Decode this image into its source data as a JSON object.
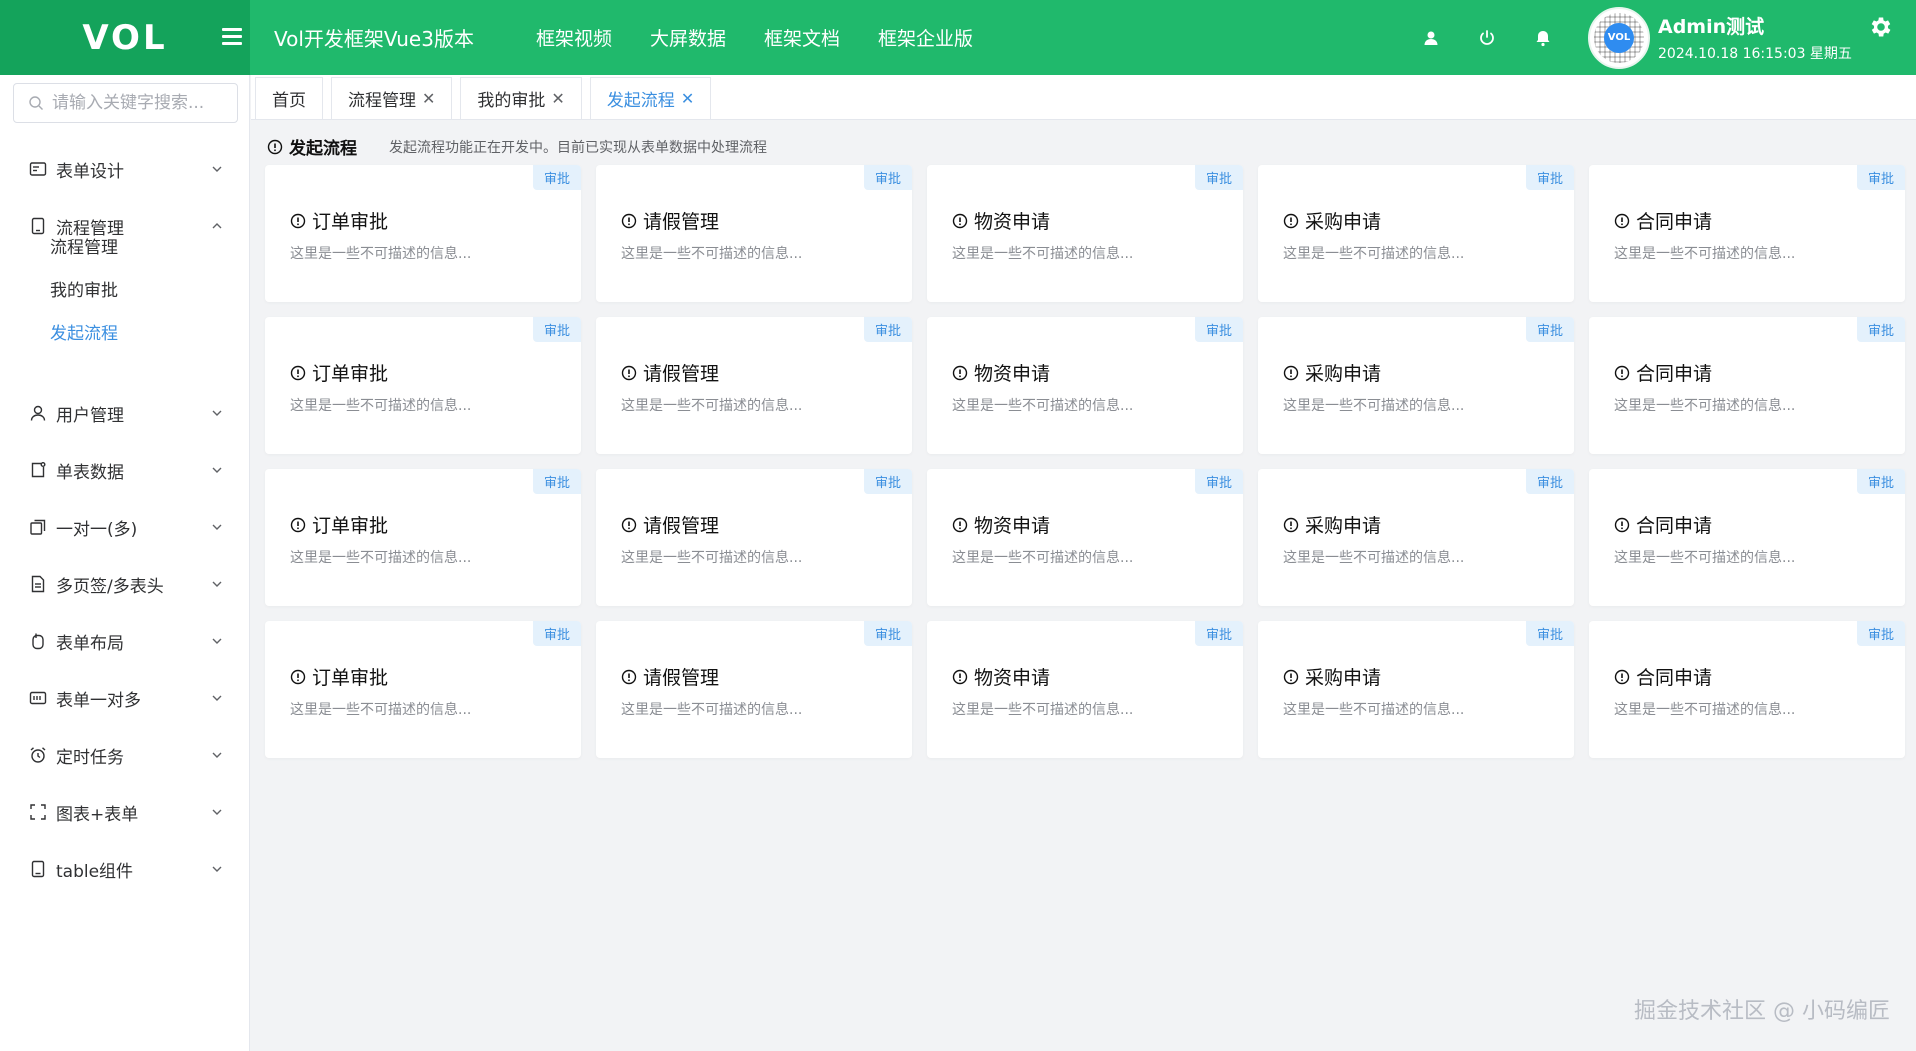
{
  "header": {
    "logo": "VOL",
    "app_title": "Vol开发框架Vue3版本",
    "nav": [
      "框架视频",
      "大屏数据",
      "框架文档",
      "框架企业版"
    ],
    "user_name": "Admin测试",
    "user_time": "2024.10.18 16:15:03 星期五",
    "avatar_text": "VOL",
    "accent": "#20b96c",
    "logo_bg": "#14a35b"
  },
  "sidebar": {
    "search_placeholder": "请输入关键字搜索...",
    "menu": [
      {
        "label": "表单设计",
        "icon": "form-design-icon",
        "expanded": false
      },
      {
        "label": "流程管理",
        "icon": "workflow-icon",
        "expanded": true
      },
      {
        "label": "用户管理",
        "icon": "user-icon",
        "expanded": false
      },
      {
        "label": "单表数据",
        "icon": "single-table-icon",
        "expanded": false
      },
      {
        "label": "一对一(多)",
        "icon": "one-to-one-icon",
        "expanded": false
      },
      {
        "label": "多页签/多表头",
        "icon": "multi-tab-icon",
        "expanded": false
      },
      {
        "label": "表单布局",
        "icon": "form-layout-icon",
        "expanded": false
      },
      {
        "label": "表单一对多",
        "icon": "form-one-many-icon",
        "expanded": false
      },
      {
        "label": "定时任务",
        "icon": "alarm-clock-icon",
        "expanded": false
      },
      {
        "label": "图表+表单",
        "icon": "chart-form-icon",
        "expanded": false
      },
      {
        "label": "table组件",
        "icon": "table-component-icon",
        "expanded": false
      }
    ],
    "submenu": [
      {
        "label": "流程管理",
        "active": false
      },
      {
        "label": "我的审批",
        "active": false
      },
      {
        "label": "发起流程",
        "active": true
      }
    ]
  },
  "tabs": [
    {
      "label": "首页",
      "closable": false,
      "active": false
    },
    {
      "label": "流程管理",
      "closable": true,
      "active": false
    },
    {
      "label": "我的审批",
      "closable": true,
      "active": false
    },
    {
      "label": "发起流程",
      "closable": true,
      "active": true
    }
  ],
  "page": {
    "title": "发起流程",
    "description": "发起流程功能正在开发中。目前已实现从表单数据中处理流程"
  },
  "cards": {
    "badge": "审批",
    "desc": "这里是一些不可描述的信息...",
    "titles": [
      "订单审批",
      "请假管理",
      "物资申请",
      "采购申请",
      "合同申请"
    ],
    "rows": 4
  },
  "watermark": "掘金技术社区 @ 小码编匠"
}
